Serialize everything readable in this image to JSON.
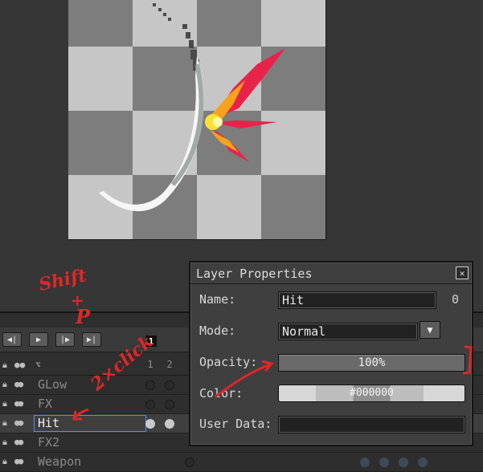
{
  "dialog": {
    "title": "Layer Properties",
    "close_icon": "close-icon",
    "name_label": "Name:",
    "name_value": "Hit",
    "layer_id": "0",
    "mode_label": "Mode:",
    "mode_value": "Normal",
    "opacity_label": "Opacity:",
    "opacity_value": "100%",
    "color_label": "Color:",
    "color_value": "#000000",
    "user_data_label": "User Data:",
    "user_data_value": ""
  },
  "timeline": {
    "controls": [
      {
        "icon": "first-frame-icon",
        "glyph": "◀|"
      },
      {
        "icon": "play-icon",
        "glyph": "▶"
      },
      {
        "icon": "next-frame-icon",
        "glyph": "|▶"
      },
      {
        "icon": "last-frame-icon",
        "glyph": "▶|"
      }
    ],
    "current_frame_marker": "1",
    "frame_numbers": [
      "1",
      "2"
    ],
    "layers": [
      {
        "name": "GLow",
        "active": false
      },
      {
        "name": "FX",
        "active": false
      },
      {
        "name": "Hit",
        "active": true
      },
      {
        "name": "FX2",
        "active": false
      },
      {
        "name": "Weapon",
        "active": false
      }
    ]
  },
  "annotations": {
    "shortcut_top": "Shift",
    "shortcut_plus": "+",
    "shortcut_key": "P",
    "double_click": "2×click"
  }
}
